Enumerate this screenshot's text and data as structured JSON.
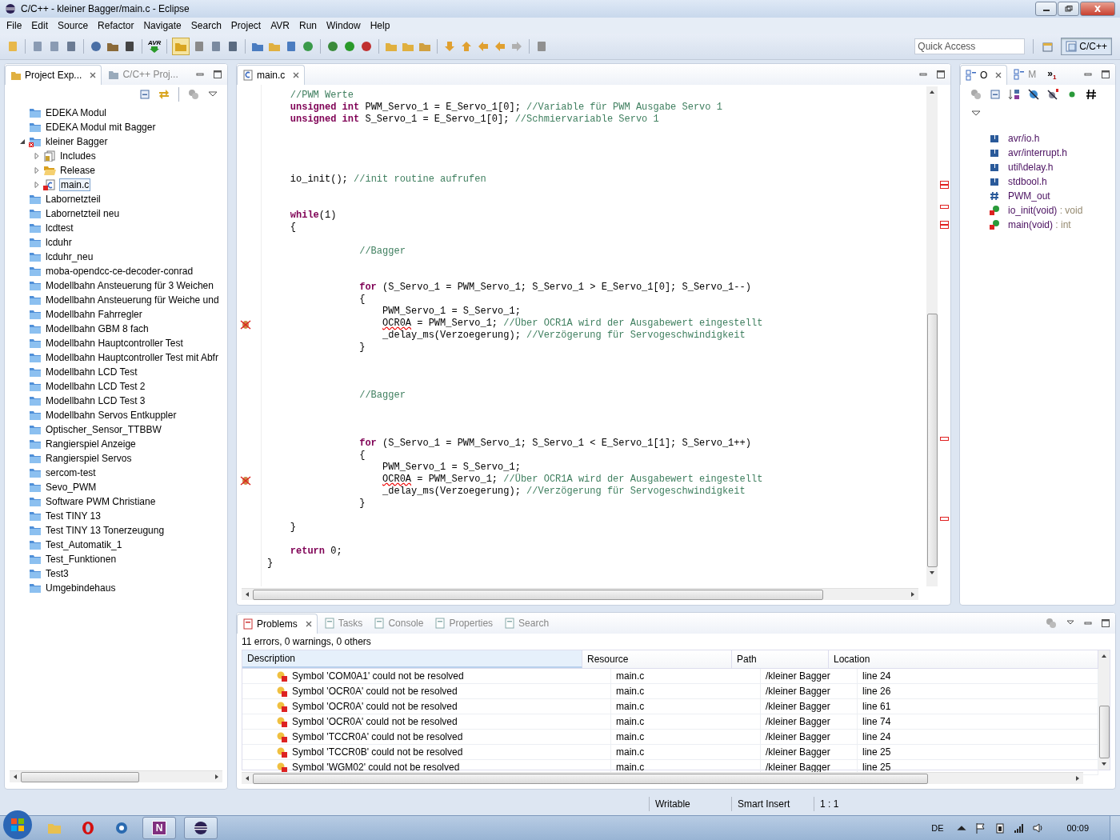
{
  "window": {
    "title": "C/C++ - kleiner Bagger/main.c - Eclipse"
  },
  "menu": [
    "File",
    "Edit",
    "Source",
    "Refactor",
    "Navigate",
    "Search",
    "Project",
    "AVR",
    "Run",
    "Window",
    "Help"
  ],
  "toolbar": {
    "avr_label": "AVR",
    "quick_access": {
      "placeholder": "Quick Access"
    },
    "perspective": {
      "label": "C/C++",
      "selected": true
    }
  },
  "explorer": {
    "tabs": [
      {
        "label": "Project Exp...",
        "selected": true
      },
      {
        "label": "C/C++ Proj...",
        "selected": false
      }
    ],
    "items": [
      {
        "kind": "folder",
        "label": "EDEKA Modul"
      },
      {
        "kind": "folder",
        "label": "EDEKA Modul mit Bagger"
      },
      {
        "kind": "project",
        "label": "kleiner Bagger",
        "expanded": true,
        "children": [
          {
            "kind": "includes",
            "label": "Includes",
            "expanded": false,
            "selected": false
          },
          {
            "kind": "open-folder",
            "label": "Release",
            "expanded": false,
            "selected": false
          },
          {
            "kind": "cfile",
            "label": "main.c",
            "expanded": false,
            "selected": true
          }
        ]
      },
      {
        "kind": "folder",
        "label": "Labornetzteil"
      },
      {
        "kind": "folder",
        "label": "Labornetzteil neu"
      },
      {
        "kind": "folder",
        "label": "lcdtest"
      },
      {
        "kind": "folder",
        "label": "lcduhr"
      },
      {
        "kind": "folder",
        "label": "lcduhr_neu"
      },
      {
        "kind": "folder",
        "label": "moba-opendcc-ce-decoder-conrad"
      },
      {
        "kind": "folder",
        "label": "Modellbahn Ansteuerung für 3 Weichen"
      },
      {
        "kind": "folder",
        "label": "Modellbahn Ansteuerung für Weiche und"
      },
      {
        "kind": "folder",
        "label": "Modellbahn Fahrregler"
      },
      {
        "kind": "folder",
        "label": "Modellbahn GBM 8 fach"
      },
      {
        "kind": "folder",
        "label": "Modellbahn Hauptcontroller Test"
      },
      {
        "kind": "folder",
        "label": "Modellbahn Hauptcontroller Test mit Abfr"
      },
      {
        "kind": "folder",
        "label": "Modellbahn LCD Test"
      },
      {
        "kind": "folder",
        "label": "Modellbahn LCD Test 2"
      },
      {
        "kind": "folder",
        "label": "Modellbahn LCD Test 3"
      },
      {
        "kind": "folder",
        "label": "Modellbahn Servos Entkuppler"
      },
      {
        "kind": "folder",
        "label": "Optischer_Sensor_TTBBW"
      },
      {
        "kind": "folder",
        "label": "Rangierspiel Anzeige"
      },
      {
        "kind": "folder",
        "label": "Rangierspiel Servos"
      },
      {
        "kind": "folder",
        "label": "sercom-test"
      },
      {
        "kind": "folder",
        "label": "Sevo_PWM"
      },
      {
        "kind": "folder",
        "label": "Software PWM Christiane"
      },
      {
        "kind": "folder",
        "label": "Test TINY 13"
      },
      {
        "kind": "folder",
        "label": "Test TINY 13 Tonerzeugung"
      },
      {
        "kind": "folder",
        "label": "Test_Automatik_1"
      },
      {
        "kind": "folder",
        "label": "Test_Funktionen"
      },
      {
        "kind": "folder",
        "label": "Test3"
      },
      {
        "kind": "folder",
        "label": "Umgebindehaus"
      }
    ]
  },
  "editor": {
    "tab": {
      "label": "main.c",
      "selected": true
    },
    "lines": [
      {
        "segments": [
          {
            "t": "    //PWM Werte",
            "kind": "comment"
          }
        ]
      },
      {
        "segments": [
          {
            "t": "    unsigned int",
            "kind": "keyword"
          },
          {
            "t": " PWM_Servo_1 = E_Servo_1[0]; ",
            "kind": "code"
          },
          {
            "t": "//Variable für PWM Ausgabe Servo 1",
            "kind": "comment"
          }
        ]
      },
      {
        "segments": [
          {
            "t": "    unsigned int",
            "kind": "keyword"
          },
          {
            "t": " S_Servo_1 = E_Servo_1[0]; ",
            "kind": "code"
          },
          {
            "t": "//Schmiervariable Servo 1",
            "kind": "comment"
          }
        ]
      },
      {
        "blank": true
      },
      {
        "blank": true
      },
      {
        "blank": true
      },
      {
        "blank": true
      },
      {
        "segments": [
          {
            "t": "    io_init(); ",
            "kind": "code"
          },
          {
            "t": "//init routine aufrufen",
            "kind": "comment"
          }
        ]
      },
      {
        "blank": true
      },
      {
        "blank": true
      },
      {
        "segments": [
          {
            "t": "    while",
            "kind": "keyword"
          },
          {
            "t": "(1)",
            "kind": "code"
          }
        ]
      },
      {
        "segments": [
          {
            "t": "    {",
            "kind": "code"
          }
        ]
      },
      {
        "blank": true
      },
      {
        "segments": [
          {
            "t": "                //Bagger",
            "kind": "comment"
          }
        ]
      },
      {
        "blank": true
      },
      {
        "blank": true
      },
      {
        "segments": [
          {
            "t": "                for",
            "kind": "keyword"
          },
          {
            "t": " (S_Servo_1 = PWM_Servo_1; S_Servo_1 > E_Servo_1[0]; S_Servo_1--)",
            "kind": "code"
          }
        ]
      },
      {
        "segments": [
          {
            "t": "                {",
            "kind": "code"
          }
        ]
      },
      {
        "segments": [
          {
            "t": "                    PWM_Servo_1 = S_Servo_1;",
            "kind": "code"
          }
        ]
      },
      {
        "error_marker": true,
        "segments": [
          {
            "t": "                    OCR0A",
            "kind": "error"
          },
          {
            "t": " = PWM_Servo_1; ",
            "kind": "code"
          },
          {
            "t": "//Über OCR1A wird der Ausgabewert eingestellt",
            "kind": "comment"
          }
        ]
      },
      {
        "segments": [
          {
            "t": "                    _delay_ms(Verzoegerung); ",
            "kind": "code"
          },
          {
            "t": "//Verzögerung für Servogeschwindigkeit",
            "kind": "comment"
          }
        ]
      },
      {
        "segments": [
          {
            "t": "                }",
            "kind": "code"
          }
        ]
      },
      {
        "blank": true
      },
      {
        "blank": true
      },
      {
        "blank": true
      },
      {
        "segments": [
          {
            "t": "                //Bagger",
            "kind": "comment"
          }
        ]
      },
      {
        "blank": true
      },
      {
        "blank": true
      },
      {
        "blank": true
      },
      {
        "segments": [
          {
            "t": "                for",
            "kind": "keyword"
          },
          {
            "t": " (S_Servo_1 = PWM_Servo_1; S_Servo_1 < E_Servo_1[1]; S_Servo_1++)",
            "kind": "code"
          }
        ]
      },
      {
        "segments": [
          {
            "t": "                {",
            "kind": "code"
          }
        ]
      },
      {
        "segments": [
          {
            "t": "                    PWM_Servo_1 = S_Servo_1;",
            "kind": "code"
          }
        ]
      },
      {
        "error_marker": true,
        "segments": [
          {
            "t": "                    OCR0A",
            "kind": "error"
          },
          {
            "t": " = PWM_Servo_1; ",
            "kind": "code"
          },
          {
            "t": "//Über OCR1A wird der Ausgabewert eingestellt",
            "kind": "comment"
          }
        ]
      },
      {
        "segments": [
          {
            "t": "                    _delay_ms(Verzoegerung); ",
            "kind": "code"
          },
          {
            "t": "//Verzögerung für Servogeschwindigkeit",
            "kind": "comment"
          }
        ]
      },
      {
        "segments": [
          {
            "t": "                }",
            "kind": "code"
          }
        ]
      },
      {
        "blank": true
      },
      {
        "segments": [
          {
            "t": "    }",
            "kind": "code"
          }
        ]
      },
      {
        "blank": true
      },
      {
        "segments": [
          {
            "t": "    return",
            "kind": "keyword"
          },
          {
            "t": " 0;",
            "kind": "code"
          }
        ]
      },
      {
        "segments": [
          {
            "t": "}",
            "kind": "code"
          }
        ]
      }
    ]
  },
  "outline": {
    "tabs": [
      {
        "label": "O",
        "selected": true
      },
      {
        "label": "M",
        "selected": false
      }
    ],
    "overflow": "»",
    "overflow_count": "1",
    "items": [
      {
        "kind": "include",
        "label": "avr/io.h"
      },
      {
        "kind": "include",
        "label": "avr/interrupt.h"
      },
      {
        "kind": "include",
        "label": "util\\delay.h"
      },
      {
        "kind": "include",
        "label": "stdbool.h"
      },
      {
        "kind": "macro",
        "label": "PWM_out"
      },
      {
        "kind": "function",
        "label": "io_init(void)",
        "type": " : void"
      },
      {
        "kind": "function",
        "label": "main(void)",
        "type": " : int"
      }
    ]
  },
  "problems": {
    "tabs": [
      {
        "label": "Problems",
        "selected": true
      },
      {
        "label": "Tasks",
        "selected": false
      },
      {
        "label": "Console",
        "selected": false
      },
      {
        "label": "Properties",
        "selected": false
      },
      {
        "label": "Search",
        "selected": false
      }
    ],
    "summary": "11 errors, 0 warnings, 0 others",
    "columns": [
      "Description",
      "Resource",
      "Path",
      "Location"
    ],
    "rows": [
      {
        "description": "Symbol 'COM0A1' could not be resolved",
        "resource": "main.c",
        "path": "/kleiner Bagger",
        "location": "line 24"
      },
      {
        "description": "Symbol 'OCR0A' could not be resolved",
        "resource": "main.c",
        "path": "/kleiner Bagger",
        "location": "line 26"
      },
      {
        "description": "Symbol 'OCR0A' could not be resolved",
        "resource": "main.c",
        "path": "/kleiner Bagger",
        "location": "line 61"
      },
      {
        "description": "Symbol 'OCR0A' could not be resolved",
        "resource": "main.c",
        "path": "/kleiner Bagger",
        "location": "line 74"
      },
      {
        "description": "Symbol 'TCCR0A' could not be resolved",
        "resource": "main.c",
        "path": "/kleiner Bagger",
        "location": "line 24"
      },
      {
        "description": "Symbol 'TCCR0B' could not be resolved",
        "resource": "main.c",
        "path": "/kleiner Bagger",
        "location": "line 25"
      },
      {
        "description": "Symbol 'WGM02' could not be resolved",
        "resource": "main.c",
        "path": "/kleiner Bagger",
        "location": "line 25"
      }
    ]
  },
  "status_bar": [
    "Writable",
    "Smart Insert",
    "1 : 1"
  ],
  "taskbar": {
    "onenote_glyph": "N",
    "language": "DE",
    "clock": "00:09"
  }
}
